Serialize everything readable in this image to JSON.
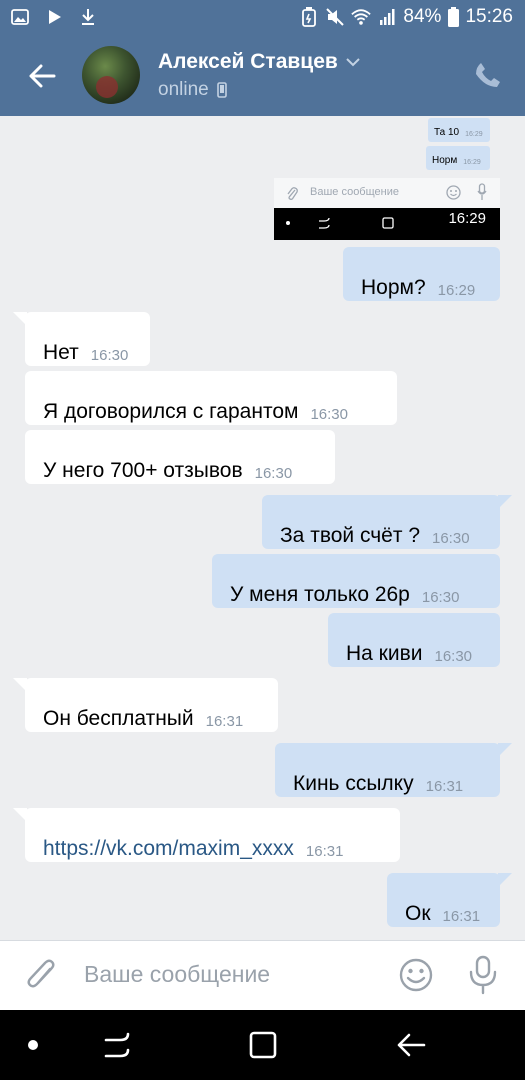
{
  "statusbar": {
    "battery": "84%",
    "time": "15:26",
    "icons": [
      "image-icon",
      "play-icon",
      "download-icon",
      "battery-saver-icon",
      "mute-icon",
      "wifi-icon",
      "signal-icon",
      "battery-icon"
    ]
  },
  "header": {
    "name": "Алексей Ставцев",
    "status": "online",
    "icons": [
      "back-arrow-icon",
      "chevron-down-icon",
      "mobile-icon",
      "phone-icon"
    ]
  },
  "embedded_screenshot": {
    "bubble1_text": "Та 10",
    "bubble1_time": "16:29",
    "bubble2_text": "Норм",
    "bubble2_time": "16:29",
    "placeholder": "Ваше сообщение",
    "time": "16:29"
  },
  "messages": [
    {
      "dir": "out",
      "text": "Норм?",
      "time": "16:29"
    },
    {
      "dir": "in",
      "text": "Нет",
      "time": "16:30"
    },
    {
      "dir": "in",
      "text": "Я договорился с гарантом",
      "time": "16:30"
    },
    {
      "dir": "in",
      "text": "У него 700+ отзывов",
      "time": "16:30"
    },
    {
      "dir": "out",
      "text": "За твой счёт ?",
      "time": "16:30"
    },
    {
      "dir": "out",
      "text": "У меня только 26р",
      "time": "16:30"
    },
    {
      "dir": "out",
      "text": "На киви",
      "time": "16:30"
    },
    {
      "dir": "in",
      "text": "Он бесплатный",
      "time": "16:31"
    },
    {
      "dir": "out",
      "text": "Кинь ссылку",
      "time": "16:31"
    },
    {
      "dir": "in",
      "text": "https://vk.com/maxim_xxxx",
      "time": "16:31"
    },
    {
      "dir": "out",
      "text": "Ок",
      "time": "16:31"
    }
  ],
  "composer": {
    "placeholder": "Ваше сообщение",
    "icons": [
      "paperclip-icon",
      "smile-icon",
      "microphone-icon"
    ]
  },
  "navbar": {
    "icons": [
      "dot-icon",
      "recent-apps-icon",
      "home-icon",
      "back-icon"
    ]
  },
  "colors": {
    "header": "#507299",
    "background": "#edeef0",
    "bubble_out": "#cfe0f4",
    "bubble_in": "#ffffff",
    "link": "#2a5885"
  }
}
